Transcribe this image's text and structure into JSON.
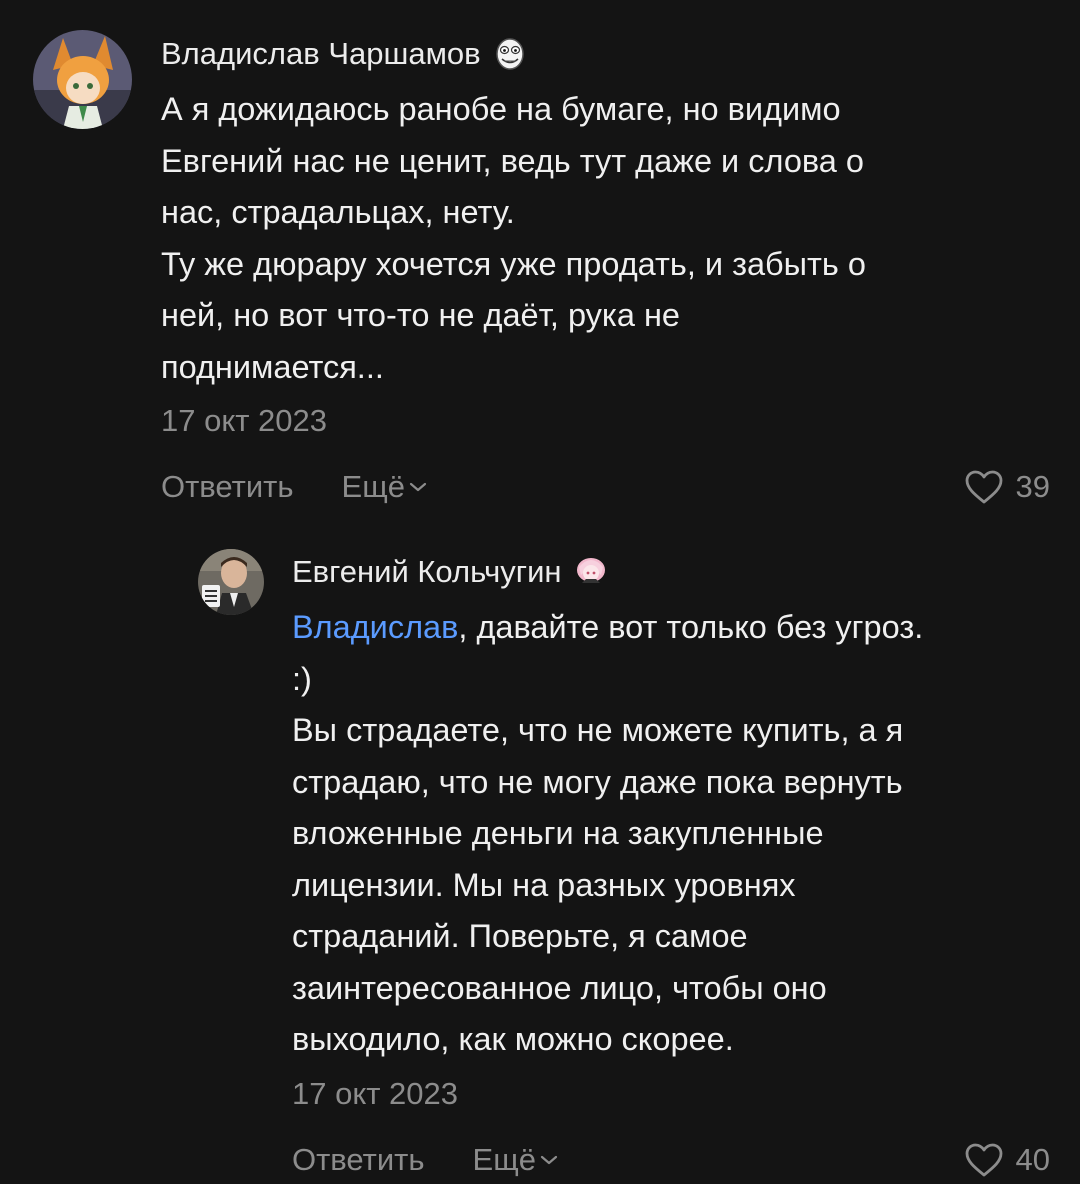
{
  "comments": [
    {
      "author": "Владислав Чаршамов",
      "text_lines": [
        "А я дожидаюсь ранобе на бумаге, но видимо",
        "Евгений нас не ценит, ведь тут даже и слова о",
        "нас, страдальцах, нету.",
        "Ту же дюрару хочется уже продать, и забыть о",
        "ней, но вот что-то не даёт, рука не",
        "поднимается..."
      ],
      "date": "17 окт 2023",
      "reply_label": "Ответить",
      "more_label": "Ещё",
      "likes": "39",
      "avatar_icon": "anime-character-avatar",
      "badge_icon": "rage-face-sticker-icon"
    },
    {
      "author": "Евгений Кольчугин",
      "mention": "Владислав",
      "mention_rest": ", давайте вот только без угроз.",
      "text_lines": [
        ":)",
        "Вы страдаете, что не можете купить, а я",
        "страдаю, что не могу даже пока вернуть",
        "вложенные деньги на закупленные",
        "лицензии. Мы на разных уровнях",
        "страданий. Поверьте, я самое",
        "заинтересованное лицо, чтобы оно",
        "выходило, как можно скорее."
      ],
      "date": "17 окт 2023",
      "reply_label": "Ответить",
      "more_label": "Ещё",
      "likes": "40",
      "avatar_icon": "man-with-mug-avatar",
      "badge_icon": "pink-anime-sticker-icon"
    }
  ],
  "colors": {
    "background": "#141414",
    "text": "#f0f0f0",
    "muted": "#8c8c8c",
    "mention": "#5b9bff"
  }
}
